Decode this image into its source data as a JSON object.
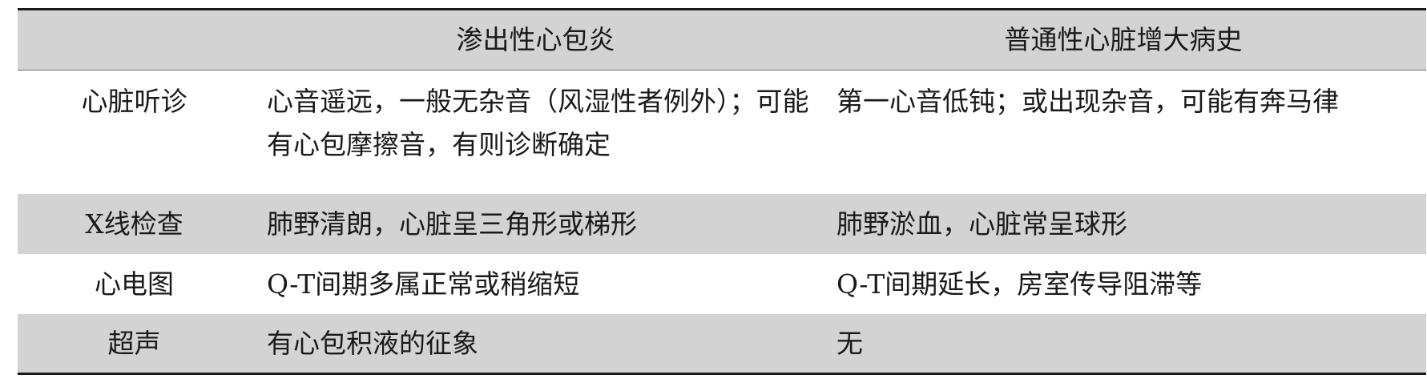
{
  "table": {
    "headers": [
      "",
      "渗出性心包炎",
      "普通性心脏增大病史"
    ],
    "rows": [
      [
        "心脏听诊",
        "心音遥远，一般无杂音（风湿性者例外）；可能有心包摩擦音，有则诊断确定",
        "第一心音低钝；或出现杂音，可能有奔马律"
      ],
      [
        "X线检查",
        "肺野清朗，心脏呈三角形或梯形",
        "肺野淤血，心脏常呈球形"
      ],
      [
        "心电图",
        "Q-T间期多属正常或稍缩短",
        "Q-T间期延长，房室传导阻滞等"
      ],
      [
        "超声",
        "有心包积液的征象",
        "无"
      ]
    ]
  }
}
